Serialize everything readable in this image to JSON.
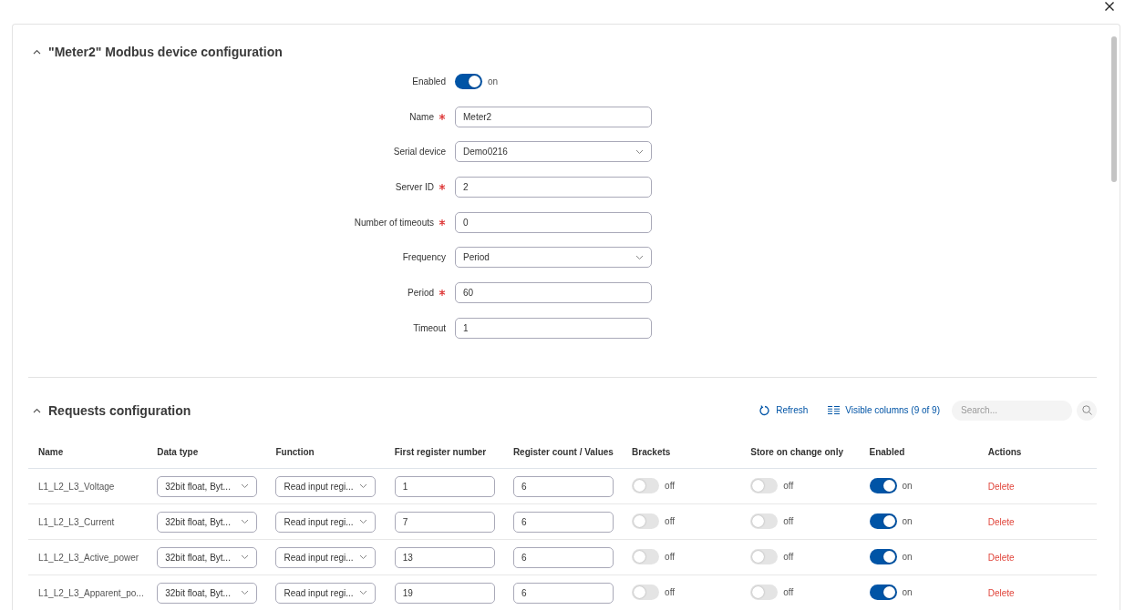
{
  "device_section": {
    "title": "\"Meter2\" Modbus device configuration",
    "expanded": true,
    "fields": [
      {
        "kind": "toggle",
        "label": "Enabled",
        "required": false,
        "on": true,
        "state_label": "on"
      },
      {
        "kind": "text",
        "label": "Name",
        "required": true,
        "value": "Meter2"
      },
      {
        "kind": "select",
        "label": "Serial device",
        "required": false,
        "value": "Demo0216"
      },
      {
        "kind": "text",
        "label": "Server ID",
        "required": true,
        "value": "2"
      },
      {
        "kind": "text",
        "label": "Number of timeouts",
        "required": true,
        "value": "0"
      },
      {
        "kind": "select",
        "label": "Frequency",
        "required": false,
        "value": "Period"
      },
      {
        "kind": "text",
        "label": "Period",
        "required": true,
        "value": "60"
      },
      {
        "kind": "text",
        "label": "Timeout",
        "required": false,
        "value": "1"
      }
    ]
  },
  "requests_section": {
    "title": "Requests configuration",
    "expanded": true,
    "toolbar": {
      "refresh": "Refresh",
      "visible_columns": "Visible columns (9 of 9)",
      "search_placeholder": "Search..."
    },
    "table": {
      "columns": [
        "Name",
        "Data type",
        "Function",
        "First register number",
        "Register count / Values",
        "Brackets",
        "Store on change only",
        "Enabled",
        "Actions"
      ],
      "rows": [
        {
          "name": "L1_L2_L3_Voltage",
          "data_type": "32bit float, Byt...",
          "function": "Read input regi...",
          "first_register": "1",
          "register_count": "6",
          "brackets": {
            "on": false,
            "label": "off"
          },
          "store_on_change": {
            "on": false,
            "label": "off"
          },
          "enabled": {
            "on": true,
            "label": "on"
          },
          "action": "Delete"
        },
        {
          "name": "L1_L2_L3_Current",
          "data_type": "32bit float, Byt...",
          "function": "Read input regi...",
          "first_register": "7",
          "register_count": "6",
          "brackets": {
            "on": false,
            "label": "off"
          },
          "store_on_change": {
            "on": false,
            "label": "off"
          },
          "enabled": {
            "on": true,
            "label": "on"
          },
          "action": "Delete"
        },
        {
          "name": "L1_L2_L3_Active_power",
          "data_type": "32bit float, Byt...",
          "function": "Read input regi...",
          "first_register": "13",
          "register_count": "6",
          "brackets": {
            "on": false,
            "label": "off"
          },
          "store_on_change": {
            "on": false,
            "label": "off"
          },
          "enabled": {
            "on": true,
            "label": "on"
          },
          "action": "Delete"
        },
        {
          "name": "L1_L2_L3_Apparent_po...",
          "data_type": "32bit float, Byt...",
          "function": "Read input regi...",
          "first_register": "19",
          "register_count": "6",
          "brackets": {
            "on": false,
            "label": "off"
          },
          "store_on_change": {
            "on": false,
            "label": "off"
          },
          "enabled": {
            "on": true,
            "label": "on"
          },
          "action": "Delete"
        }
      ]
    }
  }
}
